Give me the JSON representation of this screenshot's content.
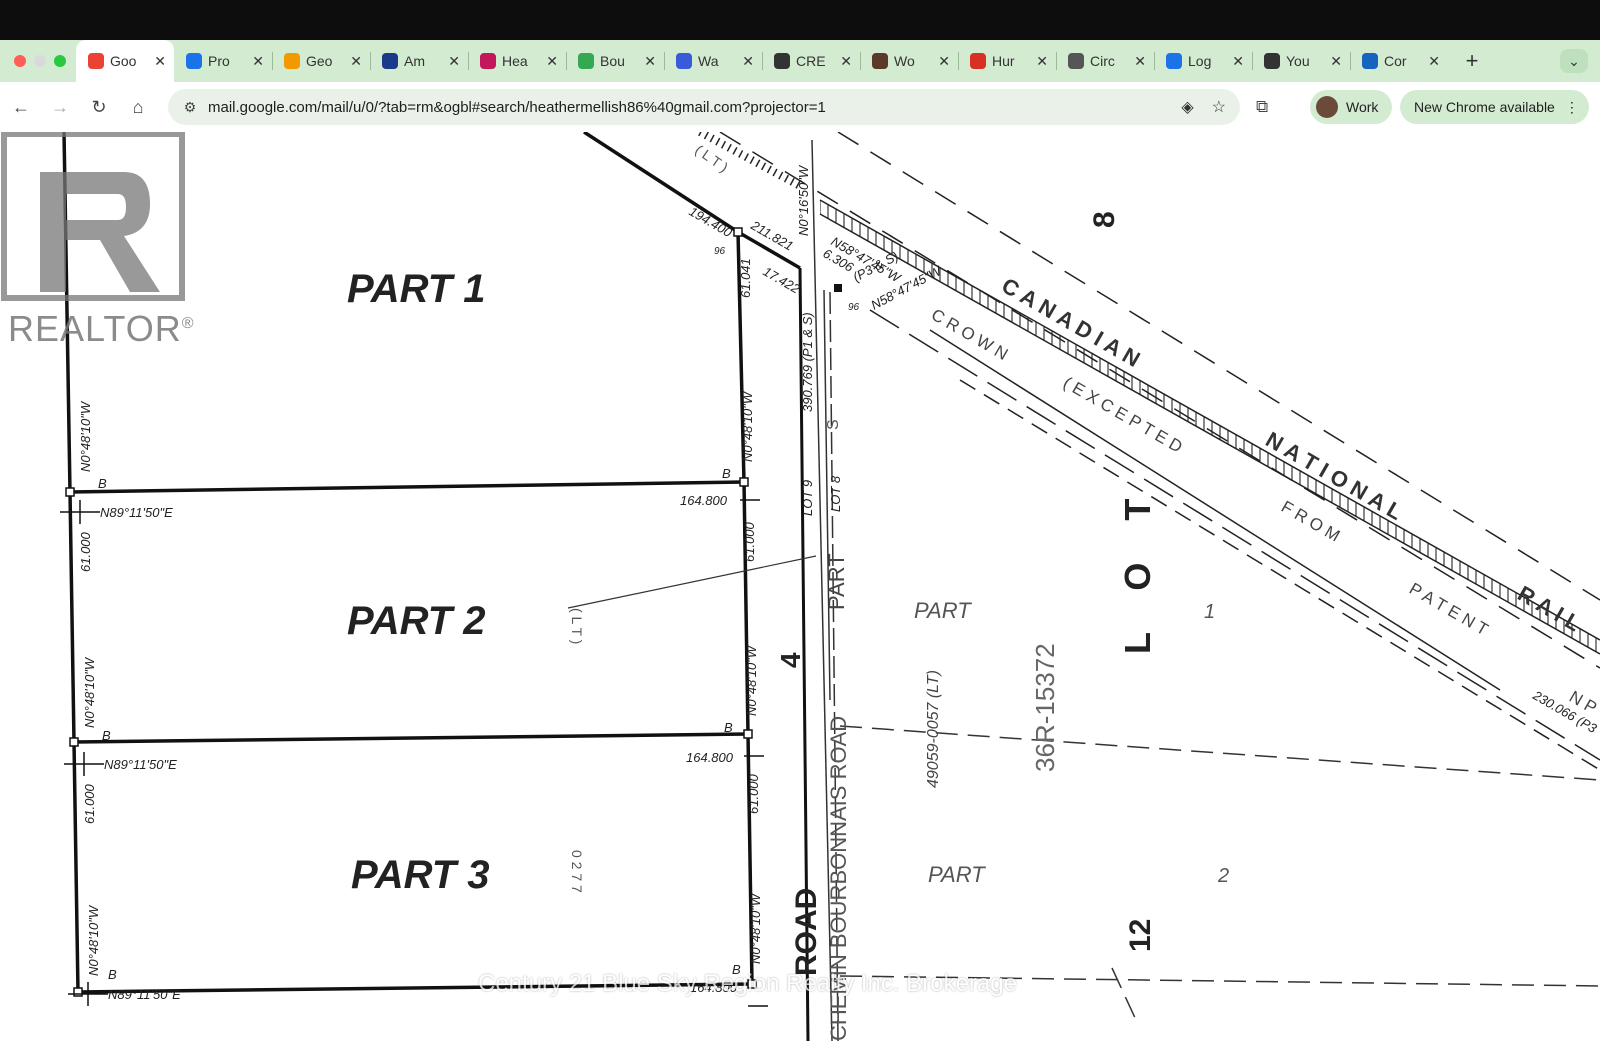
{
  "browser": {
    "traffic_lights": {
      "close": "#ff5f57",
      "minimize": "#d9d9d9",
      "zoom": "#28c840"
    },
    "tabs": [
      {
        "title": "Goo",
        "icon": "gmail-icon",
        "color": "#ea4335",
        "active": true
      },
      {
        "title": "Pro",
        "icon": "property-icon",
        "color": "#1a73e8"
      },
      {
        "title": "Geo",
        "icon": "home-icon",
        "color": "#f29900"
      },
      {
        "title": "Am",
        "icon": "chart-bars-icon",
        "color": "#1a3a8a"
      },
      {
        "title": "Hea",
        "icon": "arrow-icon",
        "color": "#c2185b"
      },
      {
        "title": "Bou",
        "icon": "drive-icon",
        "color": "#34a853"
      },
      {
        "title": "Wa",
        "icon": "wave-icon",
        "color": "#3a5bd9"
      },
      {
        "title": "CRE",
        "icon": "wordpress-icon",
        "color": "#333333"
      },
      {
        "title": "Wo",
        "icon": "house-icon",
        "color": "#5b3a29"
      },
      {
        "title": "Hur",
        "icon": "heart-icon",
        "color": "#d93025"
      },
      {
        "title": "Circ",
        "icon": "circle-chart-icon",
        "color": "#555555"
      },
      {
        "title": "Log",
        "icon": "accessibility-icon",
        "color": "#1a73e8"
      },
      {
        "title": "You",
        "icon": "playstation-icon",
        "color": "#333333"
      },
      {
        "title": "Cor",
        "icon": "globe-icon",
        "color": "#1565c0"
      }
    ],
    "close_glyph": "✕",
    "new_tab_glyph": "+",
    "tab_search_glyph": "⌄",
    "toolbar": {
      "back_glyph": "←",
      "forward_glyph": "→",
      "reload_glyph": "↻",
      "home_glyph": "⌂",
      "site_info_glyph": "⚙",
      "url": "mail.google.com/mail/u/0/?tab=rm&ogbl#search/heathermellish86%40gmail.com?projector=1",
      "lens_glyph": "◈",
      "bookmark_glyph": "☆",
      "extensions_glyph": "⧉",
      "profile_label": "Work",
      "update_label": "New Chrome available",
      "menu_glyph": "⋮"
    }
  },
  "logo": {
    "text": "REALTOR",
    "mark": "®"
  },
  "watermark": "Century 21 Blue Sky Region Realty Inc. Brokerage",
  "survey": {
    "parts": [
      "PART 1",
      "PART 2",
      "PART 3"
    ],
    "bearing_north": "N0°48'10\"W",
    "bearing_east": "N89°11'50\"E",
    "bearing_n016": "N0°16'50\"W",
    "bearing_n58": "N58°47'45\"W",
    "dist_164": "164.800",
    "dist_61": "61.000",
    "dist_61b": "61.041",
    "dist_194": "194.400",
    "dist_211": "211.821",
    "dist_17": "17.422",
    "dist_6": "6.306",
    "dist_390": "390.769 (P1 & S)",
    "dist_230": "230.066 (P3",
    "note_p3s": "(P3 & S)",
    "lt": "( L T )",
    "lt_short": "( L T )",
    "b": "B",
    "b96": "96",
    "lot9": "LOT 9",
    "lot8": "LOT 8",
    "part_road": "PART",
    "road_num": "4",
    "road": "ROAD",
    "bourbonnais": "CHEMIN BOURBONNAIS ROAD",
    "canadian": "C A N A D I A N",
    "national": "N A T I O N A L",
    "rail": "R A I L",
    "crown": "C R O W N",
    "excepted": "( E X C E P T E D",
    "from": "F R O M",
    "patent": "P A T E N T",
    "lot": "L O T",
    "lot_num": "8",
    "lot12": "12",
    "part": "PART",
    "part_num_1": "1",
    "part_num_2": "2",
    "pin": "49059-0057 (LT)",
    "plan": "36R-15372",
    "n_p": "N P",
    "s": "S",
    "num_0277": "0 2 7 7"
  }
}
